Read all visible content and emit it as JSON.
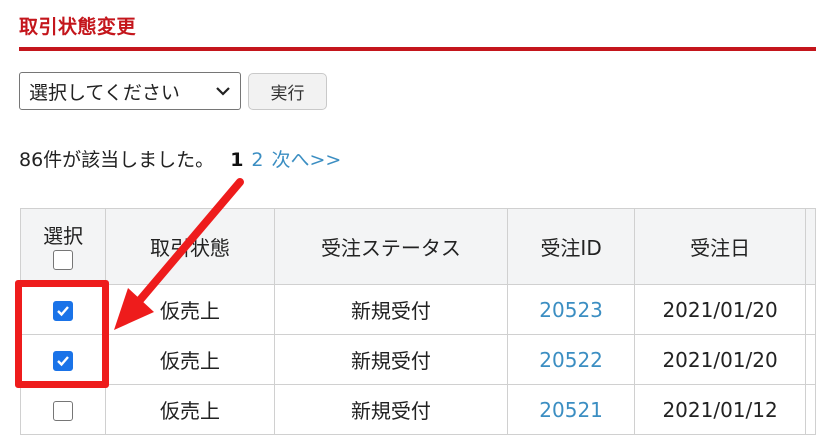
{
  "section": {
    "title": "取引状態変更"
  },
  "bulk_action": {
    "select_value": "選択してください",
    "execute_label": "実行"
  },
  "results": {
    "count_text": "86件が該当しました。",
    "current_page": "1",
    "page_links": [
      "2"
    ],
    "next_label": "次へ>>"
  },
  "table": {
    "headers": {
      "select": "選択",
      "transaction_status": "取引状態",
      "order_status": "受注ステータス",
      "order_id": "受注ID",
      "order_date": "受注日"
    },
    "rows": [
      {
        "checked": true,
        "transaction_status": "仮売上",
        "order_status": "新規受付",
        "order_id": "20523",
        "order_date": "2021/01/20"
      },
      {
        "checked": true,
        "transaction_status": "仮売上",
        "order_status": "新規受付",
        "order_id": "20522",
        "order_date": "2021/01/20"
      },
      {
        "checked": false,
        "transaction_status": "仮売上",
        "order_status": "新規受付",
        "order_id": "20521",
        "order_date": "2021/01/12"
      }
    ]
  },
  "colors": {
    "title_red": "#c4161c",
    "link_blue": "#3b8ec2",
    "checkbox_blue": "#1a73e8",
    "annotation_red": "#ee1c1c",
    "header_bg": "#f3f4f5"
  },
  "icons": {
    "select_arrow": "chevron-down-icon",
    "checkmark": "checkmark-icon",
    "annotation": "arrow-annotation"
  }
}
